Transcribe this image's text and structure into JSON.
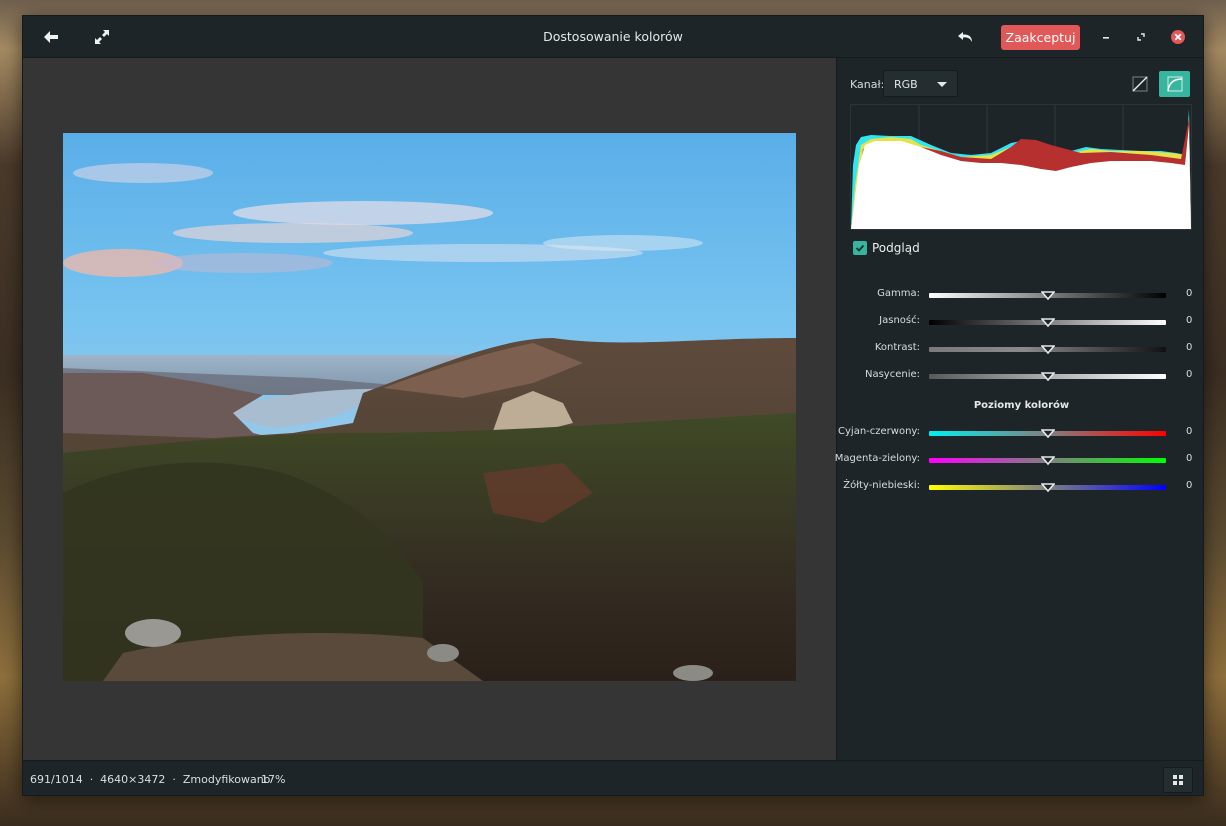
{
  "window": {
    "title": "Dostosowanie kolorów"
  },
  "header": {
    "back_icon": "arrow-left-icon",
    "fullscreen_icon": "expand-icon",
    "undo_icon": "undo-icon",
    "accept_label": "Zaakceptuj",
    "minimize_icon": "minimize-icon",
    "maximize_icon": "maximize-icon",
    "close_icon": "close-icon",
    "accept_color": "#e15858"
  },
  "sidebar": {
    "channel_label": "Kanał:",
    "channel_value": "RGB",
    "mode_linear_icon": "linear-curve-icon",
    "mode_curve_icon": "curve-icon",
    "accent_color": "#38b59e",
    "preview_label": "Podgląd",
    "preview_checked": true,
    "adjustments": [
      {
        "label": "Gamma:",
        "value": "0"
      },
      {
        "label": "Jasność:",
        "value": "0"
      },
      {
        "label": "Kontrast:",
        "value": "0"
      },
      {
        "label": "Nasycenie:",
        "value": "0"
      }
    ],
    "color_levels_title": "Poziomy kolorów",
    "color_levels": [
      {
        "label": "Cyjan-czerwony:",
        "value": "0"
      },
      {
        "label": "Magenta-zielony:",
        "value": "0"
      },
      {
        "label": "Żółty-niebieski:",
        "value": "0"
      }
    ]
  },
  "status": {
    "text": "691/1014  ·  4640×3472  ·  Zmodyfikowano",
    "zoom": "17%",
    "grid_icon": "grid-icon"
  }
}
